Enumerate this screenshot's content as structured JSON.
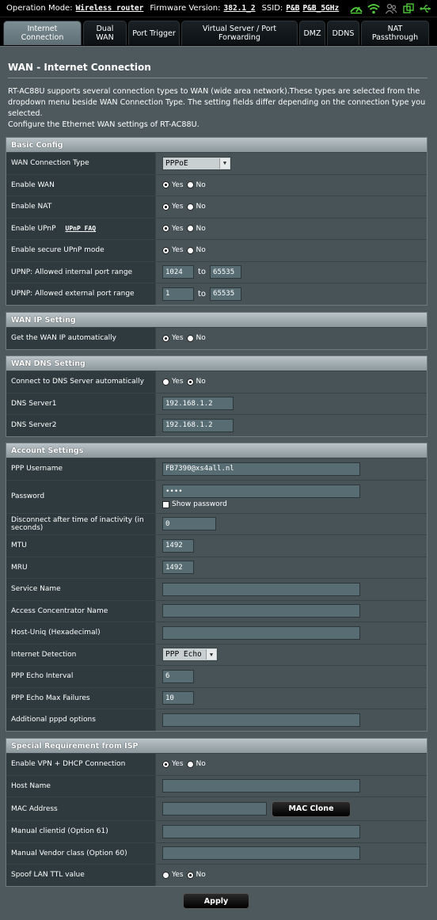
{
  "topbar": {
    "op_mode_label": "Operation Mode:",
    "op_mode": "Wireless router",
    "fw_label": "Firmware Version:",
    "fw": "382.1_2",
    "ssid_label": "SSID:",
    "ssid1": "P&B",
    "ssid2": "P&B_5GHz",
    "icons": [
      "network-status-icon",
      "wifi-icon",
      "guest-user-icon",
      "usb-copy-icon",
      "usb-icon"
    ]
  },
  "tabs": [
    "Internet Connection",
    "Dual WAN",
    "Port Trigger",
    "Virtual Server / Port Forwarding",
    "DMZ",
    "DDNS",
    "NAT Passthrough"
  ],
  "page": {
    "title": "WAN - Internet Connection",
    "desc1": "RT-AC88U supports several connection types to WAN (wide area network).These types are selected from the dropdown menu beside WAN Connection Type. The setting fields differ depending on the connection type you selected.",
    "desc2": "Configure the Ethernet WAN settings of RT-AC88U."
  },
  "common": {
    "yes": "Yes",
    "no": "No",
    "to": "to"
  },
  "basic": {
    "header": "Basic Config",
    "wan_type_label": "WAN Connection Type",
    "wan_type": "PPPoE",
    "enable_wan": "Enable WAN",
    "enable_nat": "Enable NAT",
    "enable_upnp": "Enable UPnP",
    "upnp_faq": "UPnP FAQ",
    "secure_upnp": "Enable secure UPnP mode",
    "int_range_label": "UPNP: Allowed internal port range",
    "int_from": "1024",
    "int_to": "65535",
    "ext_range_label": "UPNP: Allowed external port range",
    "ext_from": "1",
    "ext_to": "65535"
  },
  "wanip": {
    "header": "WAN IP Setting",
    "auto_label": "Get the WAN IP automatically"
  },
  "dns": {
    "header": "WAN DNS Setting",
    "auto_label": "Connect to DNS Server automatically",
    "dns1_label": "DNS Server1",
    "dns1": "192.168.1.2",
    "dns2_label": "DNS Server2",
    "dns2": "192.168.1.2"
  },
  "account": {
    "header": "Account Settings",
    "user_label": "PPP Username",
    "user": "FB7390@xs4all.nl",
    "pass_label": "Password",
    "pass": "••••",
    "show_pass": "Show password",
    "idle_label": "Disconnect after time of inactivity (in seconds)",
    "idle": "0",
    "mtu_label": "MTU",
    "mtu": "1492",
    "mru_label": "MRU",
    "mru": "1492",
    "service_label": "Service Name",
    "ac_label": "Access Concentrator Name",
    "hostuniq_label": "Host-Uniq (Hexadecimal)",
    "detect_label": "Internet Detection",
    "detect": "PPP Echo",
    "echo_int_label": "PPP Echo Interval",
    "echo_int": "6",
    "echo_fail_label": "PPP Echo Max Failures",
    "echo_fail": "10",
    "pppd_label": "Additional pppd options"
  },
  "isp": {
    "header": "Special Requirement from ISP",
    "vpn_label": "Enable VPN + DHCP Connection",
    "host_label": "Host Name",
    "mac_label": "MAC Address",
    "mac_clone": "MAC Clone",
    "clientid_label": "Manual clientid (Option 61)",
    "vendor_label": "Manual Vendor class (Option 60)",
    "ttl_label": "Spoof LAN TTL value"
  },
  "apply": "Apply",
  "colors": {
    "page_bg": "#4d595d",
    "header_bg": "#a3afb4",
    "label_bg": "#2e3a3e",
    "value_bg": "#475357",
    "icon_green": "#4fc63a"
  }
}
